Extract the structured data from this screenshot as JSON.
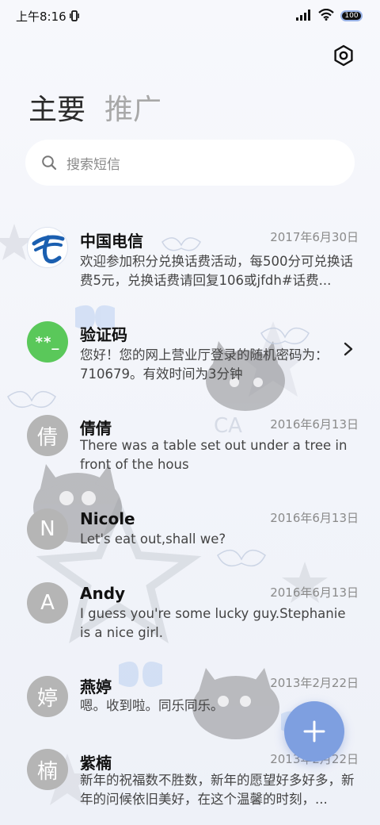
{
  "status_bar": {
    "time": "上午8:16",
    "battery": "100",
    "icons": [
      "vibrate-icon",
      "signal-icon",
      "wifi-icon",
      "battery-icon"
    ]
  },
  "header": {
    "tabs": [
      {
        "label": "主要",
        "active": true
      },
      {
        "label": "推广",
        "active": false
      }
    ]
  },
  "search": {
    "placeholder": "搜索短信",
    "icon": "search-icon"
  },
  "conversations": [
    {
      "name": "中国电信",
      "avatar_type": "telecom-logo",
      "date": "2017年6月30日",
      "preview": "欢迎参加积分兑换话费活动，每500分可兑换话费5元，兑换话费请回复106或jfdh#话费..."
    },
    {
      "name": "验证码",
      "avatar_type": "verification",
      "avatar_text": "**_",
      "date": "",
      "preview": "您好！您的网上营业厅登录的随机密码为：710679。有效时间为3分钟"
    },
    {
      "name": "倩倩",
      "avatar_text": "倩",
      "date": "2016年6月13日",
      "preview": "There was a table set out under a tree in front of the hous"
    },
    {
      "name": "Nicole",
      "avatar_text": "N",
      "date": "2016年6月13日",
      "preview": "Let's eat out,shall we?"
    },
    {
      "name": "Andy",
      "avatar_text": "A",
      "date": "2016年6月13日",
      "preview": "I guess you're some lucky guy.Stephanie is a nice girl."
    },
    {
      "name": "燕婷",
      "avatar_text": "婷",
      "date": "2013年2月22日",
      "preview": "嗯。收到啦。同乐同乐。"
    },
    {
      "name": "紫楠",
      "avatar_text": "楠",
      "date": "2013年2月22日",
      "preview": "新年的祝福数不胜数，新年的愿望好多好多，新年的问候依旧美好，在这个温馨的时刻，..."
    }
  ],
  "fab": {
    "icon": "plus-icon"
  },
  "colors": {
    "accent": "#7e9fe0",
    "verification_avatar": "#5ac85a",
    "default_avatar": "#b5b5b5",
    "telecom_blue": "#1b5fb0"
  }
}
